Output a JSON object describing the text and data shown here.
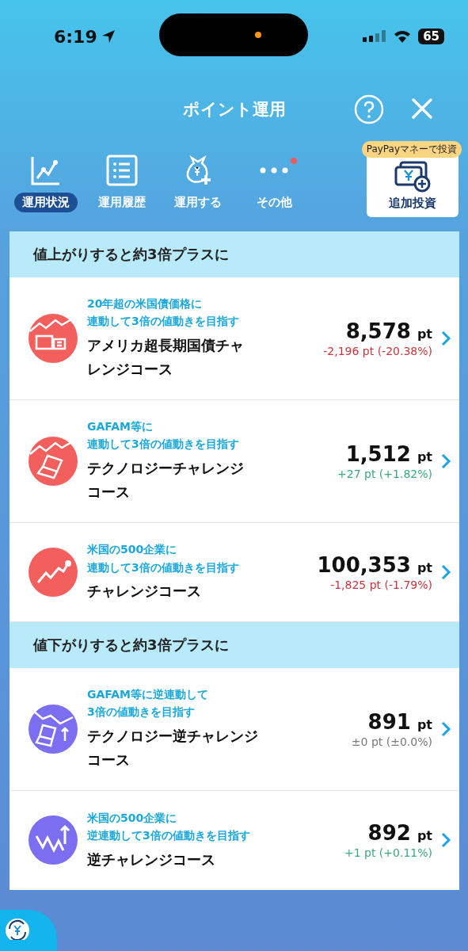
{
  "status_bar": {
    "time": "6:19",
    "battery": "65"
  },
  "header": {
    "title": "ポイント運用"
  },
  "tabs": [
    {
      "label": "運用状況",
      "selected": true,
      "kind": "chart",
      "notify": false
    },
    {
      "label": "運用履歴",
      "selected": false,
      "kind": "list",
      "notify": false
    },
    {
      "label": "運用する",
      "selected": false,
      "kind": "bag",
      "notify": false
    },
    {
      "label": "その他",
      "selected": false,
      "kind": "more",
      "notify": true
    }
  ],
  "add_button": {
    "label": "追加投資",
    "badge": "PayPayマネーで投資"
  },
  "sections": [
    {
      "title": "値上がりすると約3倍プラスに",
      "courses": [
        {
          "kind": "bond",
          "color": "#f25f5c",
          "subtitle": [
            "20年超の米国債価格に",
            "連動して3倍の値動きを目指す"
          ],
          "name": [
            "アメリカ超長期国債チャ",
            "レンジコース"
          ],
          "points": "8,578",
          "unit": "pt",
          "change": {
            "text": "-2,196 pt (-20.38%)",
            "color": "#c8353b"
          }
        },
        {
          "kind": "laptop",
          "color": "#f25f5c",
          "subtitle": [
            "GAFAM等に",
            "連動して3倍の値動きを目指す"
          ],
          "name": [
            "テクノロジーチャレンジ",
            "コース"
          ],
          "points": "1,512",
          "unit": "pt",
          "change": {
            "text": "+27 pt (+1.82%)",
            "color": "#3aa87a"
          }
        },
        {
          "kind": "rise",
          "color": "#f25f5c",
          "subtitle": [
            "米国の500企業に",
            "連動して3倍の値動きを目指す"
          ],
          "name": [
            "チャレンジコース"
          ],
          "points": "100,353",
          "unit": "pt",
          "change": {
            "text": "-1,825 pt (-1.79%)",
            "color": "#c8353b"
          }
        }
      ]
    },
    {
      "title": "値下がりすると約3倍プラスに",
      "courses": [
        {
          "kind": "laptop-inverse",
          "color": "#7b6ef0",
          "subtitle": [
            "GAFAM等に逆連動して",
            "3倍の値動きを目指す"
          ],
          "name": [
            "テクノロジー逆チャレンジ",
            "コース"
          ],
          "points": "891",
          "unit": "pt",
          "change": {
            "text": "±0 pt (±0.0%)",
            "color": "#777777"
          }
        },
        {
          "kind": "wave-inverse",
          "color": "#7b6ef0",
          "subtitle": [
            "米国の500企業に",
            "逆連動して3倍の値動きを目指す"
          ],
          "name": [
            "逆チャレンジコース"
          ],
          "points": "892",
          "unit": "pt",
          "change": {
            "text": "+1 pt (+0.11%)",
            "color": "#3aa87a"
          }
        }
      ]
    }
  ]
}
